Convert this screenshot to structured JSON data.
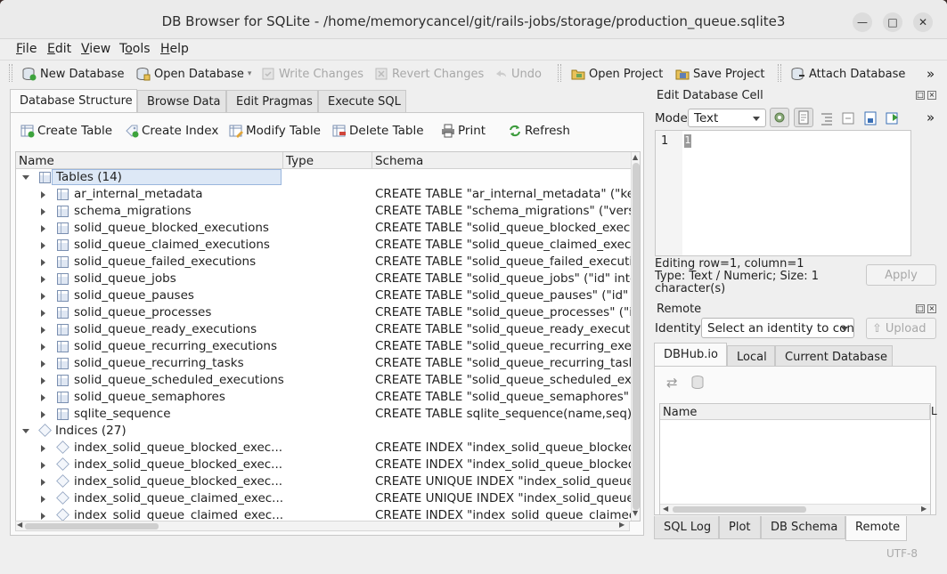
{
  "window": {
    "title": "DB Browser for SQLite - /home/memorycancel/git/rails-jobs/storage/production_queue.sqlite3"
  },
  "menu": [
    {
      "pre": "",
      "u": "F",
      "post": "ile"
    },
    {
      "pre": "",
      "u": "E",
      "post": "dit"
    },
    {
      "pre": "",
      "u": "V",
      "post": "iew"
    },
    {
      "pre": "T",
      "u": "o",
      "post": "ols"
    },
    {
      "pre": "",
      "u": "H",
      "post": "elp"
    }
  ],
  "toolbar": {
    "new_db": "New Database",
    "open_db": "Open Database",
    "write_changes": "Write Changes",
    "revert_changes": "Revert Changes",
    "undo": "Undo",
    "open_project": "Open Project",
    "save_project": "Save Project",
    "attach_db": "Attach Database",
    "more": "»"
  },
  "main_tabs": [
    "Database Structure",
    "Browse Data",
    "Edit Pragmas",
    "Execute SQL"
  ],
  "structure_toolbar": {
    "create_table": "Create Table",
    "create_index": "Create Index",
    "modify_table": "Modify Table",
    "delete_table": "Delete Table",
    "print": "Print",
    "refresh": "Refresh"
  },
  "tree": {
    "columns": [
      "Name",
      "Type",
      "Schema"
    ],
    "tables_group": "Tables (14)",
    "tables": [
      {
        "name": "ar_internal_metadata",
        "schema": "CREATE TABLE \"ar_internal_metadata\" (\"key\""
      },
      {
        "name": "schema_migrations",
        "schema": "CREATE TABLE \"schema_migrations\" (\"version\""
      },
      {
        "name": "solid_queue_blocked_executions",
        "schema": "CREATE TABLE \"solid_queue_blocked_executions\""
      },
      {
        "name": "solid_queue_claimed_executions",
        "schema": "CREATE TABLE \"solid_queue_claimed_executions\""
      },
      {
        "name": "solid_queue_failed_executions",
        "schema": "CREATE TABLE \"solid_queue_failed_executions\""
      },
      {
        "name": "solid_queue_jobs",
        "schema": "CREATE TABLE \"solid_queue_jobs\" (\"id\" integer"
      },
      {
        "name": "solid_queue_pauses",
        "schema": "CREATE TABLE \"solid_queue_pauses\" (\"id\" integer"
      },
      {
        "name": "solid_queue_processes",
        "schema": "CREATE TABLE \"solid_queue_processes\" (\"id\""
      },
      {
        "name": "solid_queue_ready_executions",
        "schema": "CREATE TABLE \"solid_queue_ready_executions\""
      },
      {
        "name": "solid_queue_recurring_executions",
        "schema": "CREATE TABLE \"solid_queue_recurring_executions\""
      },
      {
        "name": "solid_queue_recurring_tasks",
        "schema": "CREATE TABLE \"solid_queue_recurring_tasks\""
      },
      {
        "name": "solid_queue_scheduled_executions",
        "schema": "CREATE TABLE \"solid_queue_scheduled_executions\""
      },
      {
        "name": "solid_queue_semaphores",
        "schema": "CREATE TABLE \"solid_queue_semaphores\" ("
      },
      {
        "name": "sqlite_sequence",
        "schema": "CREATE TABLE sqlite_sequence(name,seq)"
      }
    ],
    "indices_group": "Indices (27)",
    "indices": [
      {
        "name": "index_solid_queue_blocked_exec...",
        "schema": "CREATE INDEX \"index_solid_queue_blocked_"
      },
      {
        "name": "index_solid_queue_blocked_exec...",
        "schema": "CREATE INDEX \"index_solid_queue_blocked_"
      },
      {
        "name": "index_solid_queue_blocked_exec...",
        "schema": "CREATE UNIQUE INDEX \"index_solid_queue_"
      },
      {
        "name": "index_solid_queue_claimed_exec...",
        "schema": "CREATE UNIQUE INDEX \"index_solid_queue_"
      },
      {
        "name": "index_solid_queue_claimed_exec...",
        "schema": "CREATE INDEX \"index_solid_queue_claimed_"
      }
    ]
  },
  "edit_cell": {
    "title": "Edit Database Cell",
    "mode_label": "Mode:",
    "mode_value": "Text",
    "line_number": "1",
    "cell_value": "1",
    "info_line1": "Editing row=1, column=1",
    "info_line2": "Type: Text / Numeric; Size: 1",
    "info_line3": "character(s)",
    "apply": "Apply"
  },
  "remote": {
    "title": "Remote",
    "identity_label": "Identity",
    "identity_value": "Select an identity to con",
    "upload": "Upload",
    "tabs": [
      "DBHub.io",
      "Local",
      "Current Database"
    ],
    "list_column": "Name",
    "list_column2": "L"
  },
  "bottom_tabs": [
    "SQL Log",
    "Plot",
    "DB Schema",
    "Remote"
  ],
  "status": {
    "encoding": "UTF-8"
  }
}
